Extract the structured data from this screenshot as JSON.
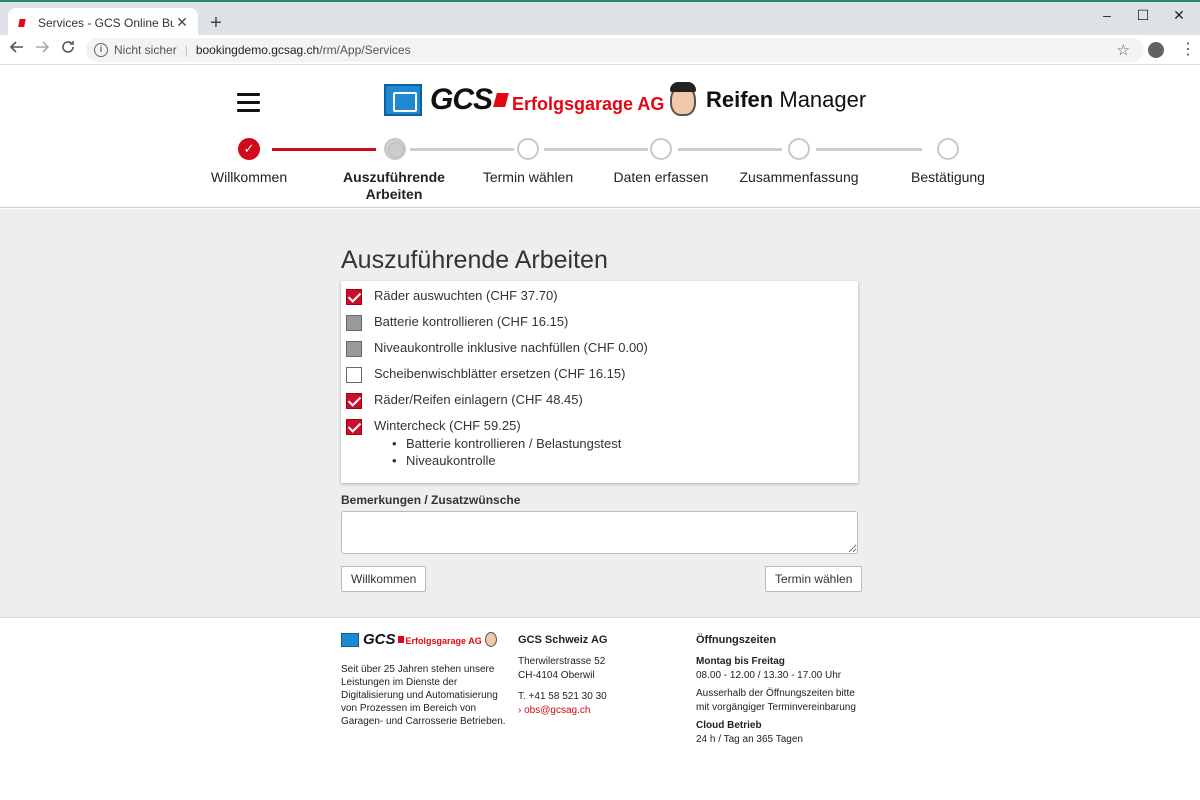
{
  "browser": {
    "tab_title": "Services - GCS Online Buchungss",
    "tab_close": "✕",
    "new_tab": "+",
    "security_label": "Nicht sicher",
    "url_host": "bookingdemo.gcsag.ch",
    "url_path": "/rm/App/Services",
    "window_controls": [
      "–",
      "☐",
      "✕"
    ]
  },
  "header": {
    "logo_text": "GCS",
    "logo_subtext": "Erfolgsgarage AG",
    "app_name_bold": "Reifen",
    "app_name_rest": "Manager"
  },
  "stepper": {
    "steps": [
      {
        "label": "Willkommen",
        "state": "done"
      },
      {
        "label": "Auszuführende Arbeiten",
        "state": "active"
      },
      {
        "label": "Termin wählen",
        "state": "pending"
      },
      {
        "label": "Daten erfassen",
        "state": "pending"
      },
      {
        "label": "Zusammenfassung",
        "state": "pending"
      },
      {
        "label": "Bestätigung",
        "state": "pending"
      }
    ]
  },
  "main": {
    "title": "Auszuführende Arbeiten",
    "services": [
      {
        "label": "Räder auswuchten (CHF 37.70)",
        "state": "checked"
      },
      {
        "label": "Batterie kontrollieren (CHF 16.15)",
        "state": "disabled"
      },
      {
        "label": "Niveaukontrolle inklusive nachfüllen (CHF 0.00)",
        "state": "disabled"
      },
      {
        "label": "Scheibenwischblätter ersetzen (CHF 16.15)",
        "state": "unchecked"
      },
      {
        "label": "Räder/Reifen einlagern (CHF 48.45)",
        "state": "checked"
      },
      {
        "label": "Wintercheck (CHF 59.25)",
        "state": "checked",
        "subitems": [
          "Batterie kontrollieren / Belastungstest",
          "Niveaukontrolle"
        ]
      }
    ],
    "remarks_label": "Bemerkungen / Zusatzwünsche",
    "remarks_value": "",
    "back_button": "Willkommen",
    "next_button": "Termin wählen"
  },
  "footer": {
    "logo_text": "GCS",
    "logo_subtext": "Erfolgsgarage AG",
    "description": "Seit über 25 Jahren stehen unsere Leistungen im Dienste der Digitalisierung und Automatisierung von Prozessen im Bereich von Garagen- und Carrosserie Betrieben.",
    "company": {
      "title": "GCS Schweiz AG",
      "street": "Therwilerstrasse 52",
      "city": "CH-4104 Oberwil",
      "phone": "T. +41 58 521 30 30",
      "email": "› obs@gcsag.ch"
    },
    "hours": {
      "title": "Öffnungszeiten",
      "weekday_label": "Montag bis Freitag",
      "weekday_hours": "08.00 - 12.00 / 13.30 - 17.00 Uhr",
      "outside_note_1": "Ausserhalb der Öffnungszeiten bitte",
      "outside_note_2": "mit vorgängiger Terminvereinbarung",
      "cloud_label": "Cloud Betrieb",
      "cloud_hours": "24 h / Tag an 365 Tagen"
    }
  }
}
